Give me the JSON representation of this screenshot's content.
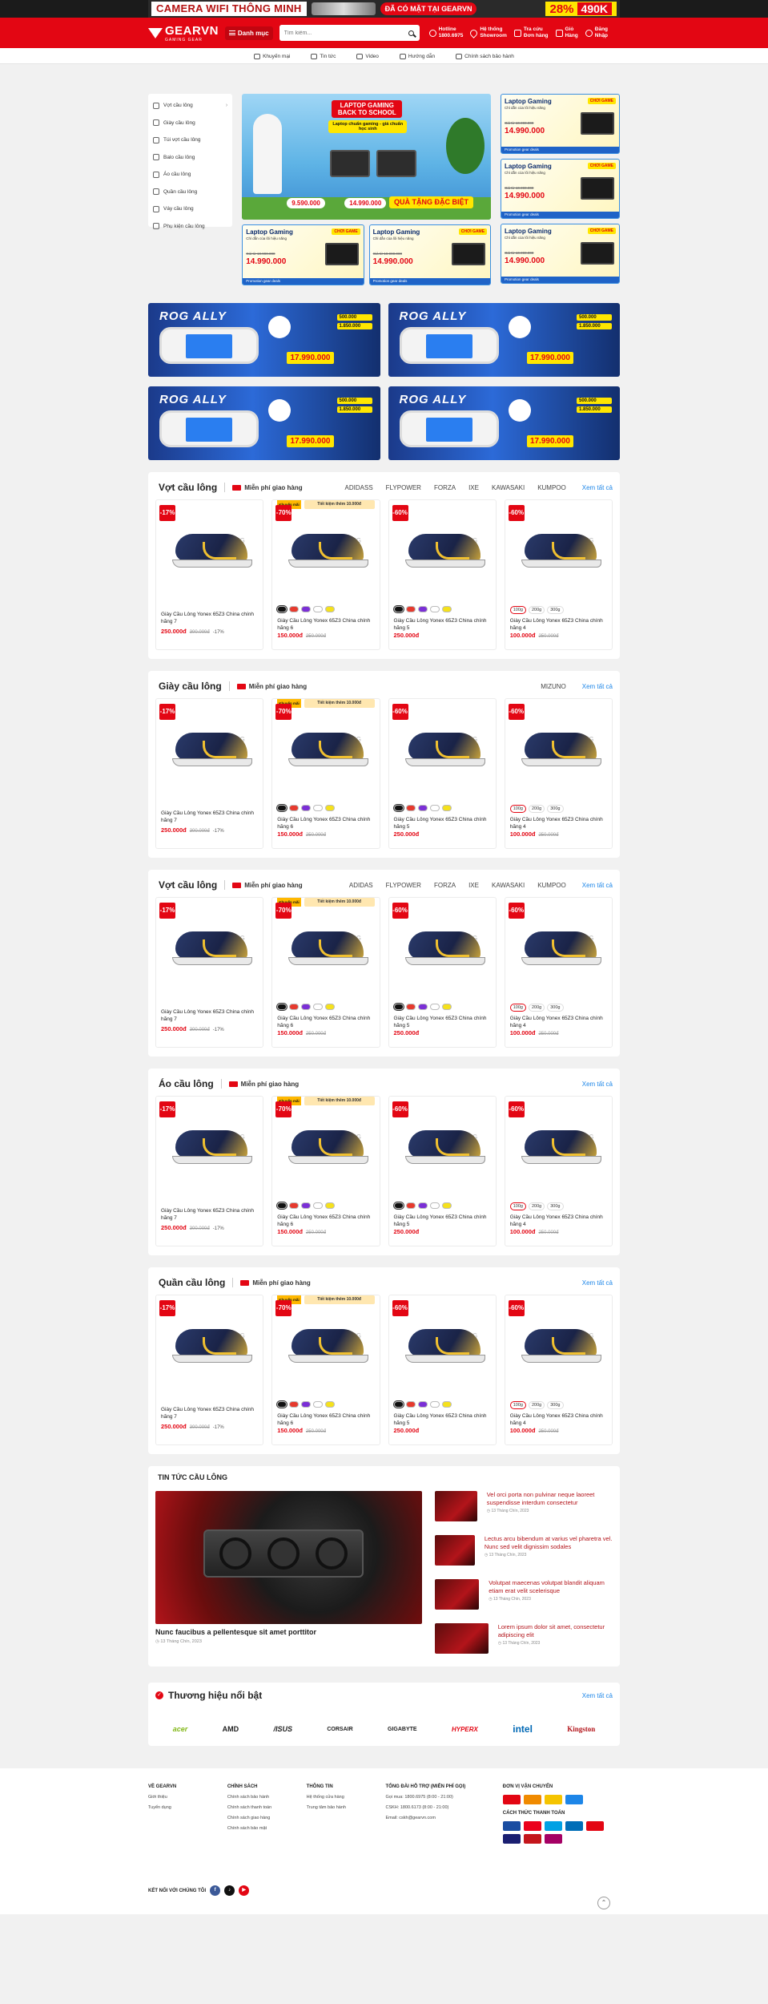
{
  "promo": {
    "headline": "CAMERA WIFI THÔNG MINH",
    "sub": "ĐÃ CÓ MẶT TẠI GEARVN",
    "discount": "28%",
    "price": "490K"
  },
  "header": {
    "logo": "GEARVN",
    "logo_sub": "GAMING GEAR",
    "menu_label": "Danh mục",
    "search_placeholder": "Tìm kiếm...",
    "links": [
      {
        "label1": "Hotline",
        "label2": "1800.6975",
        "icon": "phone-icon"
      },
      {
        "label1": "Hệ thống",
        "label2": "Showroom",
        "icon": "location-icon"
      },
      {
        "label1": "Tra cứu",
        "label2": "Đơn hàng",
        "icon": "order-icon"
      },
      {
        "label1": "Giỏ",
        "label2": "Hàng",
        "icon": "cart-icon"
      },
      {
        "label1": "Đăng",
        "label2": "Nhập",
        "icon": "user-icon"
      }
    ]
  },
  "subnav": [
    "Khuyến mại",
    "Tin tức",
    "Video",
    "Hướng dẫn",
    "Chính sách bảo hành"
  ],
  "categories": [
    "Vợt cầu lông",
    "Giày cầu lông",
    "Túi vợt cầu lông",
    "Balo cầu lông",
    "Áo cầu lông",
    "Quần cầu lông",
    "Váy cầu lông",
    "Phụ kiện cầu lông"
  ],
  "hero": {
    "title": "LAPTOP GAMING BACK TO SCHOOL",
    "subtitle": "Laptop chuẩn gaming - giá chuẩn học sinh",
    "price1": "9.590.000",
    "price2": "14.990.000",
    "gift": "QUÀ TẶNG ĐẶC BIỆT"
  },
  "laptop_card": {
    "title": "Laptop Gaming",
    "sub": "Chỉ dẫn của lõi hiệu năng",
    "badge": "CHƠI GAME",
    "old": "Giá từ 10.990.000",
    "price": "14.990.000",
    "bar": "Promotion gear deals"
  },
  "rog": {
    "title": "ROG ALLY",
    "price": "17.990.000",
    "gift1": "500.000",
    "gift2": "1.850.000"
  },
  "sections": [
    {
      "title": "Vợt cầu lông",
      "shipping": "Miễn phí giao hàng",
      "brands": [
        "ADIDASS",
        "FLYPOWER",
        "FORZA",
        "IXE",
        "KAWASAKI",
        "KUMPOO"
      ],
      "view_all": "Xem tất cả"
    },
    {
      "title": "Giày cầu lông",
      "shipping": "Miễn phí giao hàng",
      "brands": [
        "MIZUNO"
      ],
      "view_all": "Xem tất cả"
    },
    {
      "title": "Vợt cầu lông",
      "shipping": "Miễn phí giao hàng",
      "brands": [
        "ADIDAS",
        "FLYPOWER",
        "FORZA",
        "IXE",
        "KAWASAKI",
        "KUMPOO"
      ],
      "view_all": "Xem tất cả"
    },
    {
      "title": "Áo cầu lông",
      "shipping": "Miễn phí giao hàng",
      "brands": [],
      "view_all": "Xem tất cả"
    },
    {
      "title": "Quần cầu lông",
      "shipping": "Miễn phí giao hàng",
      "brands": [],
      "view_all": "Xem tất cả"
    }
  ],
  "products": [
    {
      "discount": "-17%",
      "name": "Giày Cầu Lông Yonex 65Z3 China chính hãng 7",
      "price": "250.000đ",
      "old": "300.000đ",
      "pct": "-17%",
      "variant": "none"
    },
    {
      "discount": "-70%",
      "name": "Giày Cầu Lông Yonex 65Z3 China chính hãng 6",
      "price": "150.000đ",
      "old": "250.000đ",
      "pct": "",
      "variant": "colors",
      "promo_a": "Khuyến mãi",
      "promo_b": "Tiết kiệm thêm 10.000đ"
    },
    {
      "discount": "-60%",
      "name": "Giày Cầu Lông Yonex 65Z3 China chính hãng 5",
      "price": "250.000đ",
      "old": "",
      "pct": "",
      "variant": "colors"
    },
    {
      "discount": "-60%",
      "name": "Giày Cầu Lông Yonex 65Z3 China chính hãng 4",
      "price": "100.000đ",
      "old": "250.000đ",
      "pct": "",
      "variant": "weights",
      "weights": [
        "100g",
        "200g",
        "300g"
      ]
    }
  ],
  "colors": [
    "#111111",
    "#e63a2e",
    "#7b2fd6",
    "#ffffff",
    "#f5e11c"
  ],
  "watermark": "CẦU LÔNG",
  "news": {
    "heading": "TIN TỨC CẦU LÔNG",
    "featured_title": "Nunc faucibus a pellentesque sit amet porttitor",
    "featured_date": "13 Tháng Chín, 2023",
    "items": [
      {
        "title": "Vel orci porta non pulvinar neque laoreet suspendisse interdum consectetur",
        "date": "13 Tháng Chín, 2023"
      },
      {
        "title": "Lectus arcu bibendum at varius vel pharetra vel. Nunc sed velit dignissim sodales",
        "date": "13 Tháng Chín, 2023"
      },
      {
        "title": "Volutpat maecenas volutpat blandit aliquam etiam erat velit scelerisque",
        "date": "13 Tháng Chín, 2023"
      },
      {
        "title": "Lorem ipsum dolor sit amet, consectetur adipiscing elit",
        "date": "13 Tháng Chín, 2023"
      }
    ]
  },
  "featured_brands": {
    "title": "Thương hiệu nổi bật",
    "view_all": "Xem tất cả",
    "logos": [
      "acer",
      "AMD",
      "/ISUS",
      "CORSAIR",
      "GIGABYTE",
      "HYPERX",
      "intel",
      "Kingston"
    ]
  },
  "footer": {
    "cols": [
      {
        "title": "VỀ GEARVN",
        "items": [
          "Giới thiệu",
          "Tuyển dụng"
        ]
      },
      {
        "title": "CHÍNH SÁCH",
        "items": [
          "Chính sách bảo hành",
          "Chính sách thanh toán",
          "Chính sách giao hàng",
          "Chính sách bảo mật"
        ]
      },
      {
        "title": "THÔNG TIN",
        "items": [
          "Hệ thống cửa hàng",
          "Trung tâm bảo hành"
        ]
      }
    ],
    "support_title": "TỔNG ĐÀI HỖ TRỢ (MIỄN PHÍ GỌI)",
    "support": [
      "Gọi mua: 1800.6975 (8:00 - 21:00)",
      "CSKH: 1800.6173 (8:00 - 21:00)",
      "Email: cskh@gearvn.com"
    ],
    "ship_title": "ĐƠN VỊ VẬN CHUYỂN",
    "pay_title": "CÁCH THỨC THANH TOÁN",
    "social_label": "KẾT NỐI VỚI CHÚNG TÔI"
  }
}
